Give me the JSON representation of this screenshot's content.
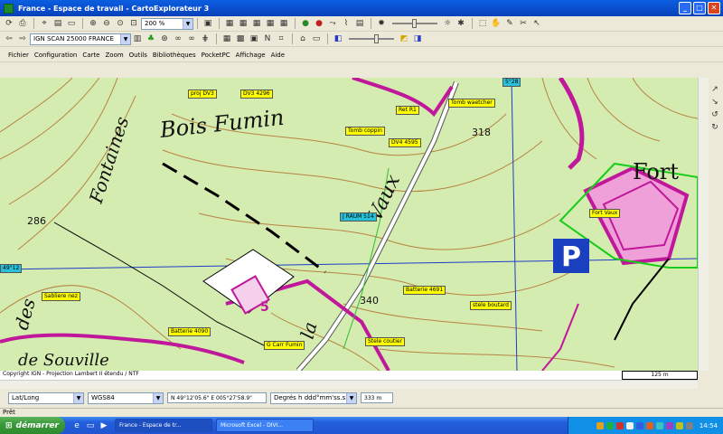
{
  "window": {
    "title": "France - Espace de travail - CartoExplorateur 3",
    "minimize": "_",
    "maximize": "□",
    "close": "✕"
  },
  "toolbar": {
    "zoom_value": "200 %",
    "map_source": "IGN SCAN 25000 FRANCE"
  },
  "menu": [
    "Fichier",
    "Configuration",
    "Carte",
    "Zoom",
    "Outils",
    "Bibliothèques",
    "PocketPC",
    "Affichage",
    "Aide"
  ],
  "map": {
    "place_names": [
      "Bois Fumin",
      "Fontaines",
      "Fort",
      "Vaux",
      "des",
      "la",
      "de Souville"
    ],
    "elevations": [
      "318",
      "286",
      "340"
    ],
    "grid_labels": {
      "lon": "5°28",
      "lat": "49°12"
    },
    "parking": "P",
    "area_number": "5",
    "scale": "125 m",
    "waypoints": [
      {
        "name": "proj DV3",
        "color": "yellow"
      },
      {
        "name": "DV3 4296",
        "color": "yellow"
      },
      {
        "name": "Ret R1",
        "color": "yellow"
      },
      {
        "name": "Tomb waetcher",
        "color": "yellow"
      },
      {
        "name": "Tomb coppin",
        "color": "yellow"
      },
      {
        "name": "DV4 4595",
        "color": "yellow"
      },
      {
        "name": "J RAUM 514",
        "color": "blue"
      },
      {
        "name": "Fort Vaux",
        "color": "yellow"
      },
      {
        "name": "Sabliere nez",
        "color": "yellow"
      },
      {
        "name": "Batterie 4691",
        "color": "yellow"
      },
      {
        "name": "stele boutard",
        "color": "yellow"
      },
      {
        "name": "Batterie 4090",
        "color": "yellow"
      },
      {
        "name": "G Carr Fumin",
        "color": "yellow"
      },
      {
        "name": "Stele coutier",
        "color": "yellow"
      }
    ]
  },
  "copyright": "Copyright IGN - Projection Lambert II étendu / NTF",
  "statusbar": {
    "coord_system": "Lat/Long",
    "datum": "WGS84",
    "position": "N 49°12'05.6\"  E 005°27'58.9\"",
    "format": "Degrés h ddd°mm'ss.s\"",
    "distance": "333 m"
  },
  "status_text": "Prêt",
  "taskbar": {
    "start": "démarrer",
    "tasks": [
      "France - Espace de tr...",
      "Microsoft Excel - DIVI..."
    ],
    "clock": "14:54"
  },
  "colors": {
    "map_bg": "#d4ecb0",
    "contour": "#b06a28",
    "road_magenta": "#c0189a",
    "titlebar": "#0a4ccc",
    "label": "#ffff00"
  }
}
